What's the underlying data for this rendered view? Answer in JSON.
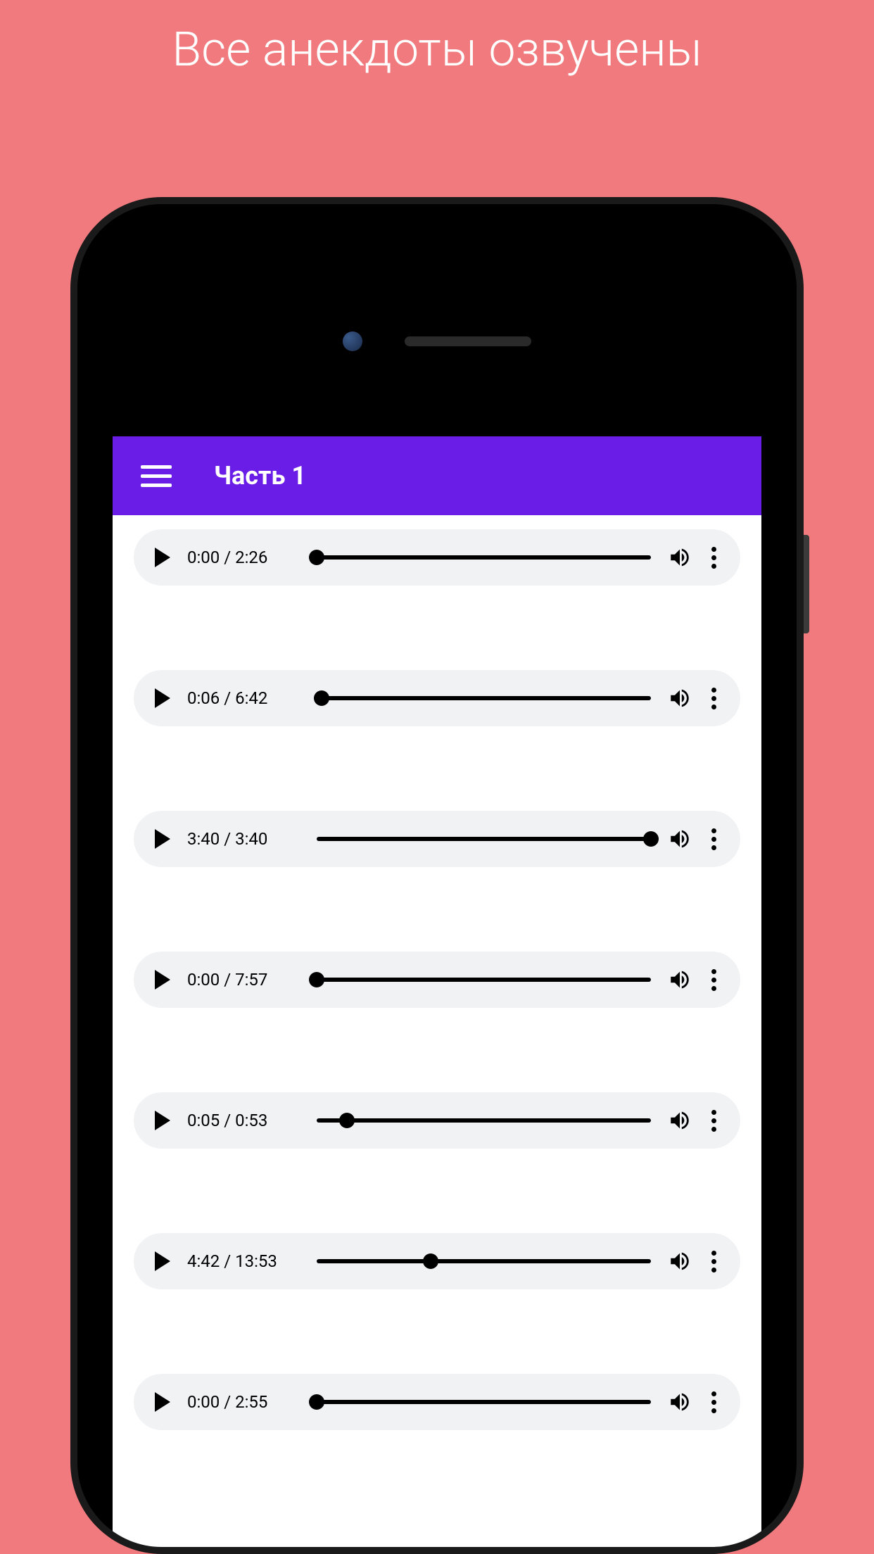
{
  "marketing": {
    "title": "Все анекдоты озвучены"
  },
  "header": {
    "title": "Часть 1"
  },
  "players": [
    {
      "current": "0:00",
      "total": "2:26",
      "progress": 0
    },
    {
      "current": "0:06",
      "total": "6:42",
      "progress": 1.5
    },
    {
      "current": "3:40",
      "total": "3:40",
      "progress": 100
    },
    {
      "current": "0:00",
      "total": "7:57",
      "progress": 0
    },
    {
      "current": "0:05",
      "total": "0:53",
      "progress": 9
    },
    {
      "current": "4:42",
      "total": "13:53",
      "progress": 34
    },
    {
      "current": "0:00",
      "total": "2:55",
      "progress": 0
    }
  ]
}
